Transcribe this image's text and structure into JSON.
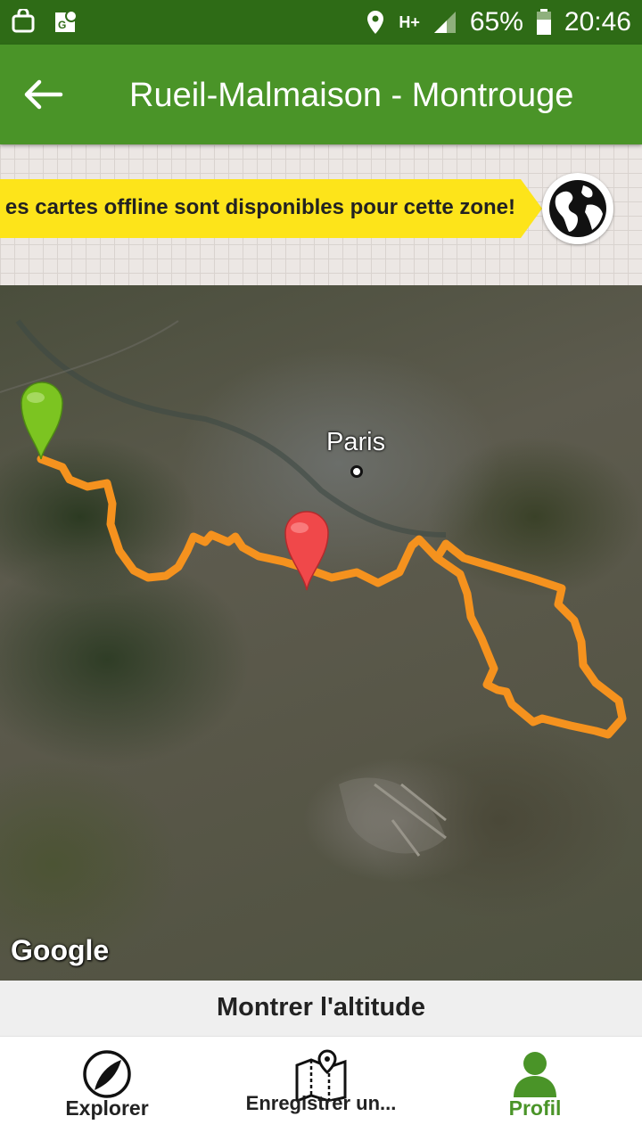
{
  "status_bar": {
    "battery": "65%",
    "time": "20:46",
    "network": "H+",
    "icons": [
      "shopping-bag-icon",
      "maps-icon",
      "location-icon",
      "signal-icon",
      "battery-icon"
    ]
  },
  "app_bar": {
    "title": "Rueil-Malmaison - Montrouge",
    "back_icon": "arrow-back-icon"
  },
  "offline_banner": {
    "text": "es cartes offline sont disponibles pour cette zone!",
    "accent_color": "#fde41a",
    "globe_icon": "globe-icon"
  },
  "map": {
    "city_label": "Paris",
    "attribution": "Google",
    "route_color": "#f5921e",
    "start_marker_color": "#7cc421",
    "current_marker_color": "#f0484a"
  },
  "altitude": {
    "label": "Montrer l'altitude"
  },
  "bottom_nav": {
    "items": [
      {
        "label": "Explorer",
        "icon": "explorer-icon"
      },
      {
        "label": "Enregistrer un...",
        "icon": "map-pin-icon"
      },
      {
        "label": "Profil",
        "icon": "profile-icon",
        "active": true
      }
    ],
    "active_color": "#4a9428"
  },
  "colors": {
    "status_bar": "#2e6b16",
    "app_bar": "#4a9428"
  }
}
